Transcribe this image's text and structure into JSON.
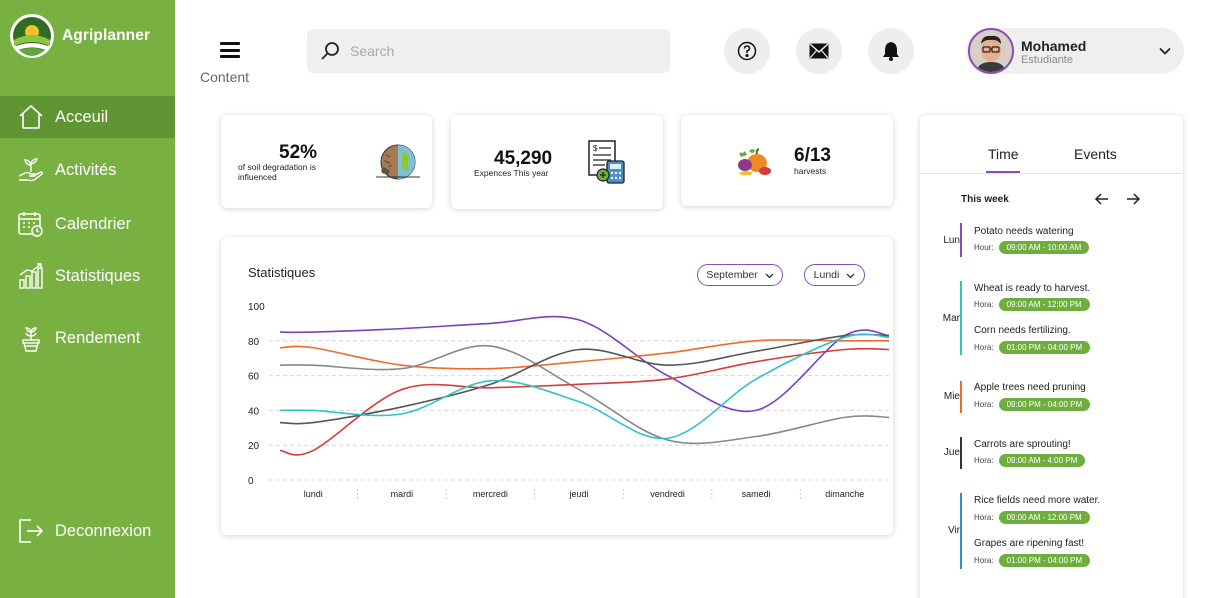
{
  "app": {
    "name": "Agriplanner"
  },
  "sidebar": {
    "items": [
      {
        "label": "Acceuil",
        "icon": "home-icon",
        "active": true
      },
      {
        "label": "Activités",
        "icon": "plant-hand-icon",
        "active": false
      },
      {
        "label": "Calendrier",
        "icon": "calendar-icon",
        "active": false
      },
      {
        "label": "Statistiques",
        "icon": "bar-chart-icon",
        "active": false
      },
      {
        "label": "Rendement",
        "icon": "potted-plant-icon",
        "active": false
      }
    ],
    "logout": {
      "label": "Deconnexion",
      "icon": "logout-icon"
    }
  },
  "header": {
    "content_label": "Content",
    "search_placeholder": "Search",
    "icons": [
      "help-icon",
      "mail-icon",
      "bell-icon"
    ],
    "user": {
      "name": "Mohamed",
      "role": "Estudiante"
    }
  },
  "stats": [
    {
      "value": "52%",
      "label": "of soil degradation is influenced",
      "icon": "soil-earth-icon"
    },
    {
      "value": "45,290",
      "label": "Expences This year",
      "icon": "invoice-calculator-icon"
    },
    {
      "value": "6/13",
      "label": "harvests",
      "icon": "vegetables-icon"
    }
  ],
  "chart": {
    "title": "Statistiques",
    "filter_month": "September",
    "filter_day": "Lundi"
  },
  "chart_data": {
    "type": "line",
    "x": [
      "lundi",
      "mardi",
      "mercredi",
      "jeudi",
      "vendredi",
      "samedi",
      "dimanche"
    ],
    "ylim": [
      0,
      100
    ],
    "yticks": [
      0,
      20,
      40,
      60,
      80,
      100
    ],
    "grid": true,
    "series": [
      {
        "color": "#7a3fbf",
        "values": [
          85,
          87,
          90,
          92,
          60,
          40,
          83
        ]
      },
      {
        "color": "#ef6b2d",
        "values": [
          76,
          66,
          64,
          68,
          73,
          80,
          80
        ]
      },
      {
        "color": "#888888",
        "values": [
          66,
          64,
          77,
          52,
          23,
          25,
          36
        ]
      },
      {
        "color": "#555555",
        "values": [
          33,
          42,
          55,
          75,
          66,
          74,
          83
        ]
      },
      {
        "color": "#d93a3a",
        "values": [
          17,
          52,
          53,
          55,
          58,
          68,
          75
        ]
      },
      {
        "color": "#2ec4c8",
        "values": [
          40,
          38,
          57,
          45,
          24,
          58,
          82
        ]
      }
    ]
  },
  "schedule": {
    "tabs": [
      "Time",
      "Events"
    ],
    "active_tab": "Time",
    "week_label": "This week",
    "days": [
      {
        "day": "Lun",
        "color": "#8b4db3",
        "events": [
          {
            "title": "Potato needs watering",
            "hour_label": "Hour:",
            "time": "09:00 AM - 10:00 AM"
          }
        ]
      },
      {
        "day": "Mar",
        "color": "#2ec4c8",
        "events": [
          {
            "title": "Wheat is ready to harvest.",
            "hour_label": "Hora:",
            "time": "09:00 AM - 12:00 PM"
          },
          {
            "title": "Corn needs fertilizing.",
            "hour_label": "Hora:",
            "time": "01:00 PM - 04:00 PM"
          }
        ]
      },
      {
        "day": "Mie",
        "color": "#ef6b2d",
        "events": [
          {
            "title": "Apple trees need pruning",
            "hour_label": "Hora:",
            "time": "09:00 PM - 04:00 PM"
          }
        ]
      },
      {
        "day": "Jue",
        "color": "#333333",
        "events": [
          {
            "title": "Carrots are sprouting!",
            "hour_label": "Hora:",
            "time": "09:00 AM - 4:00 PM"
          }
        ]
      },
      {
        "day": "Vir",
        "color": "#2e8fd1",
        "events": [
          {
            "title": "Rice fields need more water.",
            "hour_label": "Hora:",
            "time": "09:00 AM - 12:00 PM"
          },
          {
            "title": "Grapes are ripening fast!",
            "hour_label": "Hora:",
            "time": "01:00 PM - 04:00 PM"
          }
        ]
      }
    ]
  }
}
